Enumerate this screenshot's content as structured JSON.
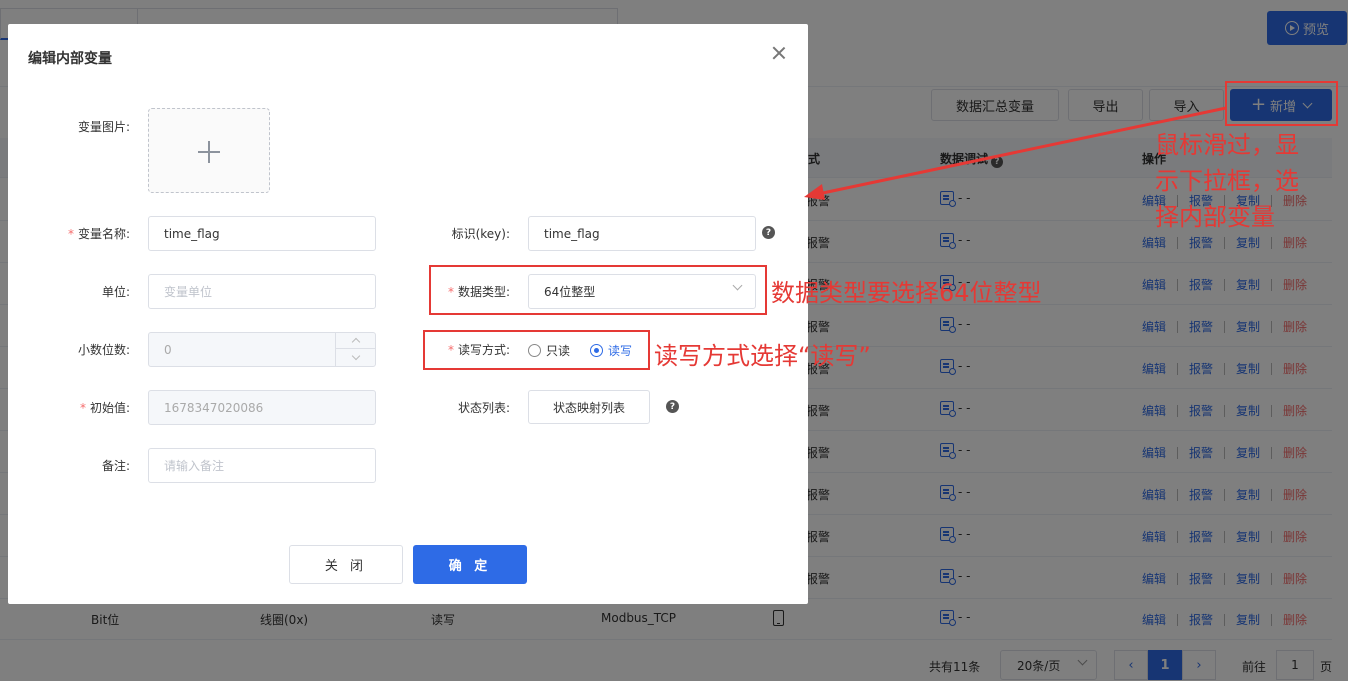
{
  "background": {
    "preview_label": "预览",
    "toolbar": {
      "summary_label": "数据汇总变量",
      "export_label": "导出",
      "import_label": "导入",
      "add_label": "新增"
    },
    "table": {
      "headers": [
        "式",
        "数据调试",
        "操作"
      ],
      "alarm_text": "报警",
      "debug_text": "- -",
      "ops": {
        "edit": "编辑",
        "alarm": "报警",
        "copy": "复制",
        "delete": "删除"
      },
      "last_row": {
        "type": "Bit位",
        "register": "线圈(0x)",
        "rw": "读写",
        "protocol": "Modbus_TCP"
      }
    },
    "pagination": {
      "total_prefix": "共有",
      "total_count": "11",
      "total_suffix": "条",
      "page_size": "20条/页",
      "current_page": "1",
      "goto_label": "前往",
      "goto_value": "1",
      "page_suffix": "页"
    }
  },
  "modal": {
    "title": "编辑内部变量",
    "image_label": "变量图片:",
    "name_label": "变量名称:",
    "name_value": "time_flag",
    "key_label": "标识(key):",
    "key_value": "time_flag",
    "unit_label": "单位:",
    "unit_placeholder": "变量单位",
    "datatype_label": "数据类型:",
    "datatype_value": "64位整型",
    "decimal_label": "小数位数:",
    "decimal_value": "0",
    "rw_label": "读写方式:",
    "rw_options": [
      "只读",
      "读写"
    ],
    "rw_selected": "读写",
    "initial_label": "初始值:",
    "initial_value": "1678347020086",
    "state_label": "状态列表:",
    "state_button": "状态映射列表",
    "remark_label": "备注:",
    "remark_placeholder": "请输入备注",
    "close_label": "关 闭",
    "ok_label": "确 定"
  },
  "annotations": {
    "add_hint": [
      "鼠标滑过，显",
      "示下拉框，选",
      "择内部变量"
    ],
    "datatype_hint": "数据类型要选择64位整型",
    "rw_hint": "读写方式选择“读写”",
    "color": "#e53935"
  },
  "colors": {
    "primary": "#2e6be6",
    "danger": "#f56c6c",
    "annotation": "#e53935"
  }
}
